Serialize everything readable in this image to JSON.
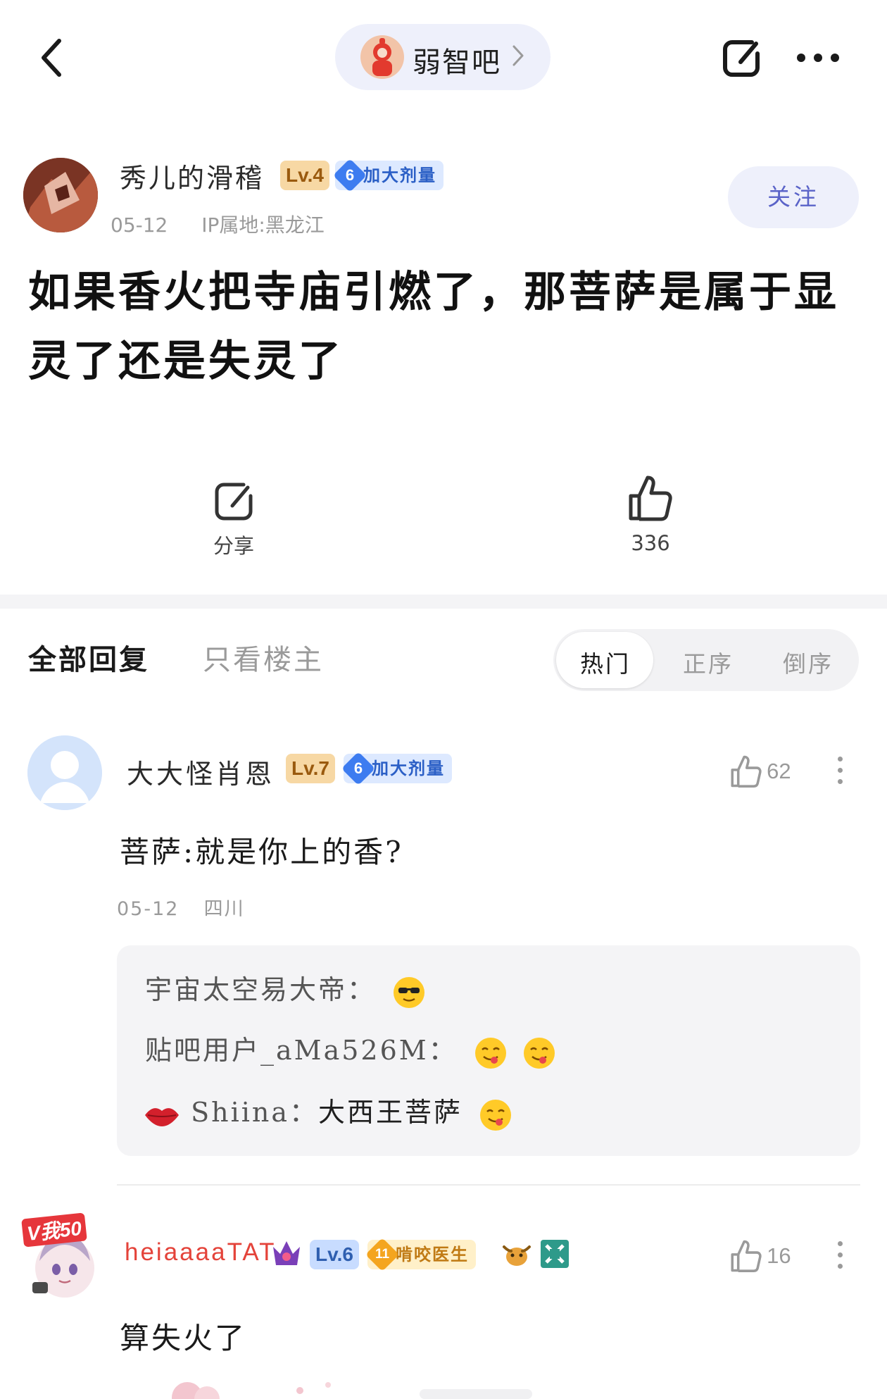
{
  "topbar": {
    "back_icon": "chevron-left-icon",
    "forum_name": "弱智吧",
    "share_icon": "share-icon",
    "more_icon": "more-dots-icon"
  },
  "post": {
    "author": {
      "name": "秀儿的滑稽",
      "level": "Lv.4",
      "tag_level": "6",
      "tag_label": "加大剂量",
      "date": "05-12",
      "ip": "IP属地:黑龙江"
    },
    "follow_label": "关注",
    "title_line1": "如果香火把寺庙引燃了，那菩萨是属于显",
    "title_line2": "灵了还是失灵了",
    "actions": {
      "share_label": "分享",
      "like_count": "336"
    }
  },
  "tabs": {
    "all_replies": "全部回复",
    "only_op": "只看楼主",
    "sort_hot": "热门",
    "sort_asc": "正序",
    "sort_desc": "倒序"
  },
  "comments": [
    {
      "name": "大大怪肖恩",
      "level": "Lv.7",
      "tag_level": "6",
      "tag_label": "加大剂量",
      "likes": "62",
      "body": "菩萨:就是你上的香?",
      "date": "05-12",
      "location": "四川",
      "replies": [
        {
          "user": "宇宙太空易大帝：",
          "text": ""
        },
        {
          "user": "贴吧用户_aMa526M：",
          "text": ""
        },
        {
          "user": "Shiina：",
          "text": "大西王菩萨"
        }
      ]
    },
    {
      "vip_badge": "V我50",
      "name": "heiaaaaTAT",
      "level": "Lv.6",
      "tag_level": "11",
      "tag_label": "啃咬医生",
      "likes": "16",
      "body": "算失火了"
    }
  ],
  "colors": {
    "accent": "#5a63c8",
    "pill_bg": "#eef0fb",
    "vip_name": "#e4433a"
  }
}
